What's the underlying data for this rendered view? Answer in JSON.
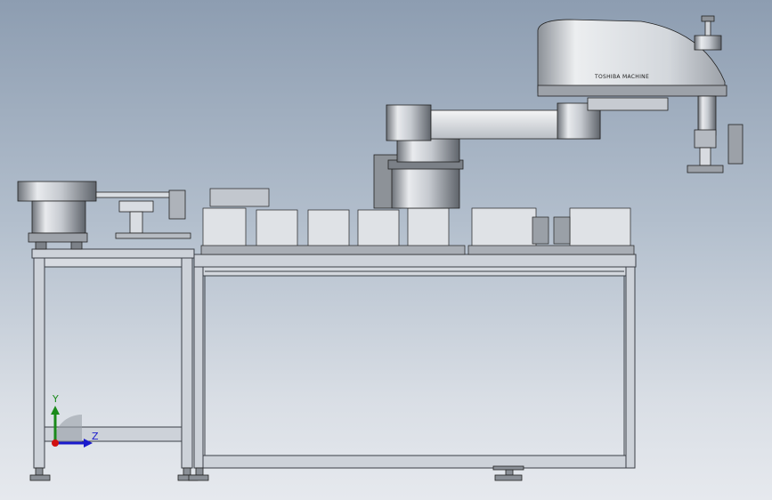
{
  "viewport": {
    "background_top": "#8d9db1",
    "background_bottom": "#e6e9ee"
  },
  "robot": {
    "brand_text": "TOSHIBA MACHINE"
  },
  "triad": {
    "y_label": "Y",
    "z_label": "Z",
    "colors": {
      "y": "#1a8a1a",
      "z": "#1a1acc",
      "origin": "#d01010"
    }
  },
  "colors": {
    "frame_fill": "#c9ced6",
    "frame_stroke": "#3a3f46",
    "metal_light": "#e8eaed",
    "metal_dark": "#6f747b",
    "edge": "#222222"
  }
}
